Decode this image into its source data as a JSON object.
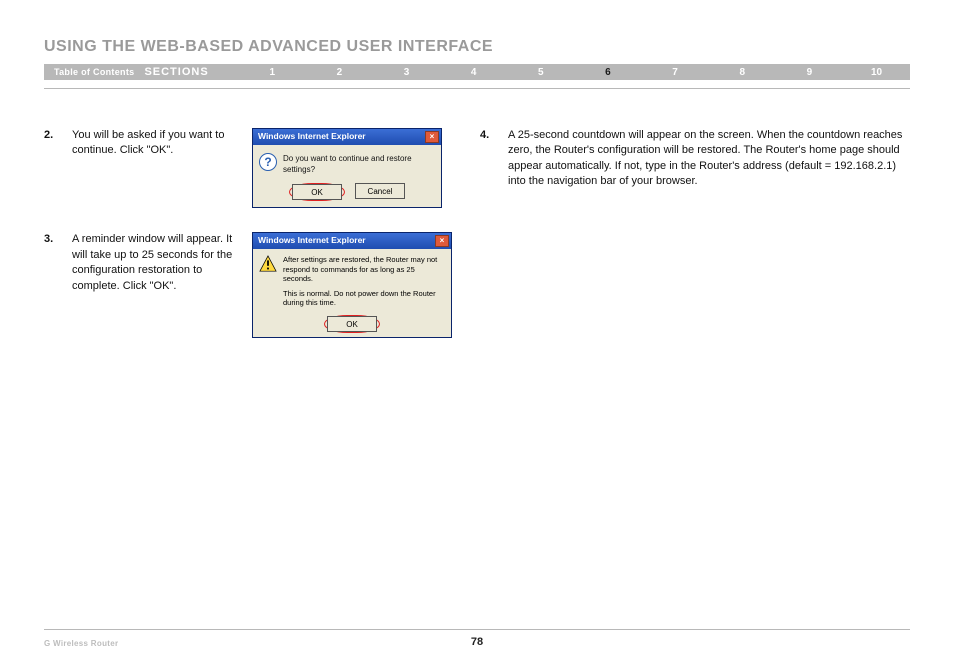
{
  "heading": "USING THE WEB-BASED ADVANCED USER INTERFACE",
  "nav": {
    "toc": "Table of Contents",
    "sections": "SECTIONS",
    "items": [
      "1",
      "2",
      "3",
      "4",
      "5",
      "6",
      "7",
      "8",
      "9",
      "10"
    ],
    "active_index": 5
  },
  "steps": {
    "s2": {
      "num": "2.",
      "text": "You will be asked if you want to continue. Click \"OK\"."
    },
    "s3": {
      "num": "3.",
      "text": "A reminder window will appear. It will take up to 25 seconds for the configuration restoration to complete. Click \"OK\"."
    },
    "s4": {
      "num": "4.",
      "text": "A 25-second countdown will appear on the screen. When the countdown reaches zero, the Router's configuration will be restored. The Router's home page should appear automatically. If not, type in the Router's address (default = 192.168.2.1) into the navigation bar of your browser."
    }
  },
  "dialog1": {
    "title": "Windows Internet Explorer",
    "message": "Do you want to continue and restore settings?",
    "ok": "OK",
    "cancel": "Cancel"
  },
  "dialog2": {
    "title": "Windows Internet Explorer",
    "line1": "After settings are restored, the Router may not respond to commands for as long as 25 seconds.",
    "line2": "This is normal. Do not power down the Router during this time.",
    "ok": "OK"
  },
  "footer": {
    "product": "G Wireless Router",
    "page": "78"
  }
}
